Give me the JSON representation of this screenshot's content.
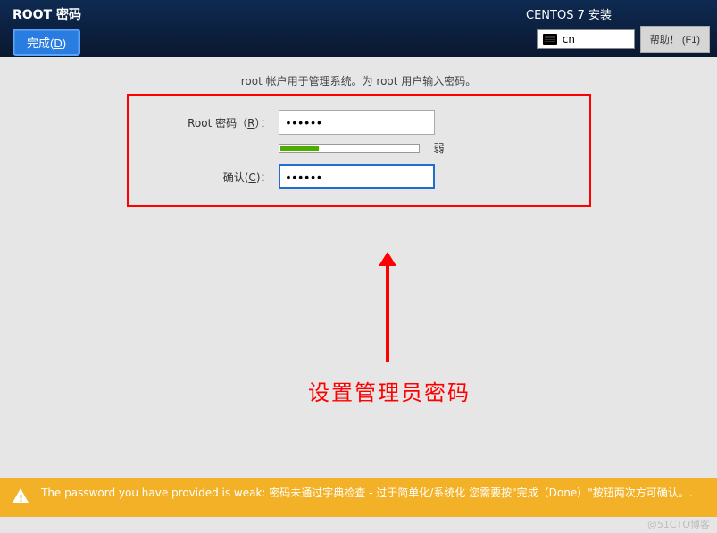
{
  "header": {
    "page_title": "ROOT 密码",
    "done_label": "完成(D)",
    "install_title": "CENTOS 7 安装",
    "lang_code": "cn",
    "help_label": "帮助！ (F1)"
  },
  "form": {
    "instruction": "root 帐户用于管理系统。为 root 用户输入密码。",
    "password_label_pre": "Root 密码（",
    "password_label_key": "R",
    "password_label_post": "）：",
    "password_value": "••••••",
    "confirm_label_pre": "确认(",
    "confirm_label_key": "C",
    "confirm_label_post": ")：",
    "confirm_value": "••••••",
    "strength_text": "弱"
  },
  "annotation": {
    "note": "设置管理员密码"
  },
  "warning": {
    "text": "The password you have provided is weak: 密码未通过字典检查 - 过于简单化/系统化 您需要按\"完成（Done）\"按钮两次方可确认。."
  },
  "watermark": "@51CTO博客"
}
